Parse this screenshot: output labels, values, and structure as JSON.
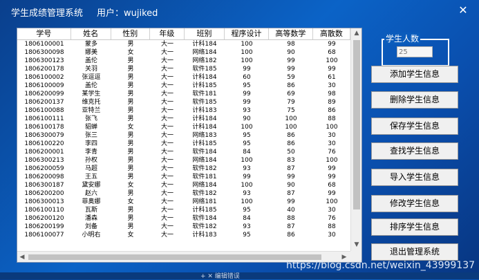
{
  "window": {
    "title": "学生成绩管理系统",
    "user_label": "用户：wujiked",
    "close_glyph": "✕"
  },
  "table": {
    "columns": [
      "学号",
      "姓名",
      "性别",
      "年级",
      "班别",
      "程序设计",
      "高等数学",
      "高散数"
    ],
    "rows": [
      [
        "1806100001",
        "蒙多",
        "男",
        "大一",
        "计科184",
        "100",
        "98",
        "99"
      ],
      [
        "1806300098",
        "娜美",
        "女",
        "大一",
        "网络184",
        "100",
        "90",
        "68"
      ],
      [
        "1806300123",
        "盖伦",
        "男",
        "大一",
        "网络182",
        "100",
        "99",
        "100"
      ],
      [
        "1806200178",
        "关羽",
        "男",
        "大一",
        "软件185",
        "99",
        "99",
        "99"
      ],
      [
        "1806100002",
        "张逗逗",
        "男",
        "大一",
        "计科184",
        "60",
        "59",
        "61"
      ],
      [
        "1806100009",
        "盖伦",
        "男",
        "大一",
        "计科185",
        "95",
        "86",
        "30"
      ],
      [
        "1806200099",
        "某学生",
        "男",
        "大一",
        "软件181",
        "99",
        "69",
        "98"
      ],
      [
        "1806200137",
        "维克托",
        "男",
        "大一",
        "软件185",
        "99",
        "79",
        "89"
      ],
      [
        "1806100088",
        "亚特兰",
        "男",
        "大一",
        "计科183",
        "93",
        "75",
        "86"
      ],
      [
        "1806100111",
        "张飞",
        "男",
        "大一",
        "计科184",
        "90",
        "100",
        "88"
      ],
      [
        "1806100178",
        "貂蝉",
        "女",
        "大一",
        "计科184",
        "100",
        "100",
        "100"
      ],
      [
        "1806300079",
        "张三",
        "男",
        "大一",
        "网络183",
        "95",
        "86",
        "30"
      ],
      [
        "1806100220",
        "李四",
        "男",
        "大一",
        "计科185",
        "95",
        "86",
        "30"
      ],
      [
        "1806200001",
        "李青",
        "男",
        "大一",
        "软件184",
        "84",
        "50",
        "76"
      ],
      [
        "1806300213",
        "孙权",
        "男",
        "大一",
        "网络184",
        "100",
        "83",
        "100"
      ],
      [
        "1806200059",
        "马超",
        "男",
        "大一",
        "软件182",
        "93",
        "87",
        "99"
      ],
      [
        "1806200098",
        "王五",
        "男",
        "大一",
        "软件181",
        "99",
        "99",
        "99"
      ],
      [
        "1806300187",
        "黛安娜",
        "女",
        "大一",
        "网络184",
        "100",
        "90",
        "68"
      ],
      [
        "1806200200",
        "赵六",
        "男",
        "大一",
        "软件182",
        "93",
        "87",
        "99"
      ],
      [
        "1806300013",
        "菲奥娜",
        "女",
        "大一",
        "网络181",
        "100",
        "99",
        "100"
      ],
      [
        "1806100110",
        "瓦斯",
        "男",
        "大一",
        "计科185",
        "95",
        "40",
        "30"
      ],
      [
        "1806200120",
        "潘森",
        "男",
        "大一",
        "软件184",
        "84",
        "88",
        "76"
      ],
      [
        "1806200199",
        "刘备",
        "男",
        "大一",
        "软件182",
        "93",
        "87",
        "88"
      ],
      [
        "1806100077",
        "小明右",
        "女",
        "大一",
        "计科183",
        "95",
        "86",
        "30"
      ]
    ]
  },
  "scroll": {
    "up": "▲",
    "down": "▼",
    "left": "◀",
    "right": "▶"
  },
  "count": {
    "label": "学生人数",
    "value": "25"
  },
  "buttons": {
    "add": "添加学生信息",
    "delete": "删除学生信息",
    "save": "保存学生信息",
    "find": "查找学生信息",
    "import": "导入学生信息",
    "modify": "修改学生信息",
    "sort": "排序学生信息",
    "exit": "退出管理系统"
  },
  "watermark": "https://blog.csdn.net/weixin_43999137",
  "taskbar_text": "+ ✕      编辑错误"
}
